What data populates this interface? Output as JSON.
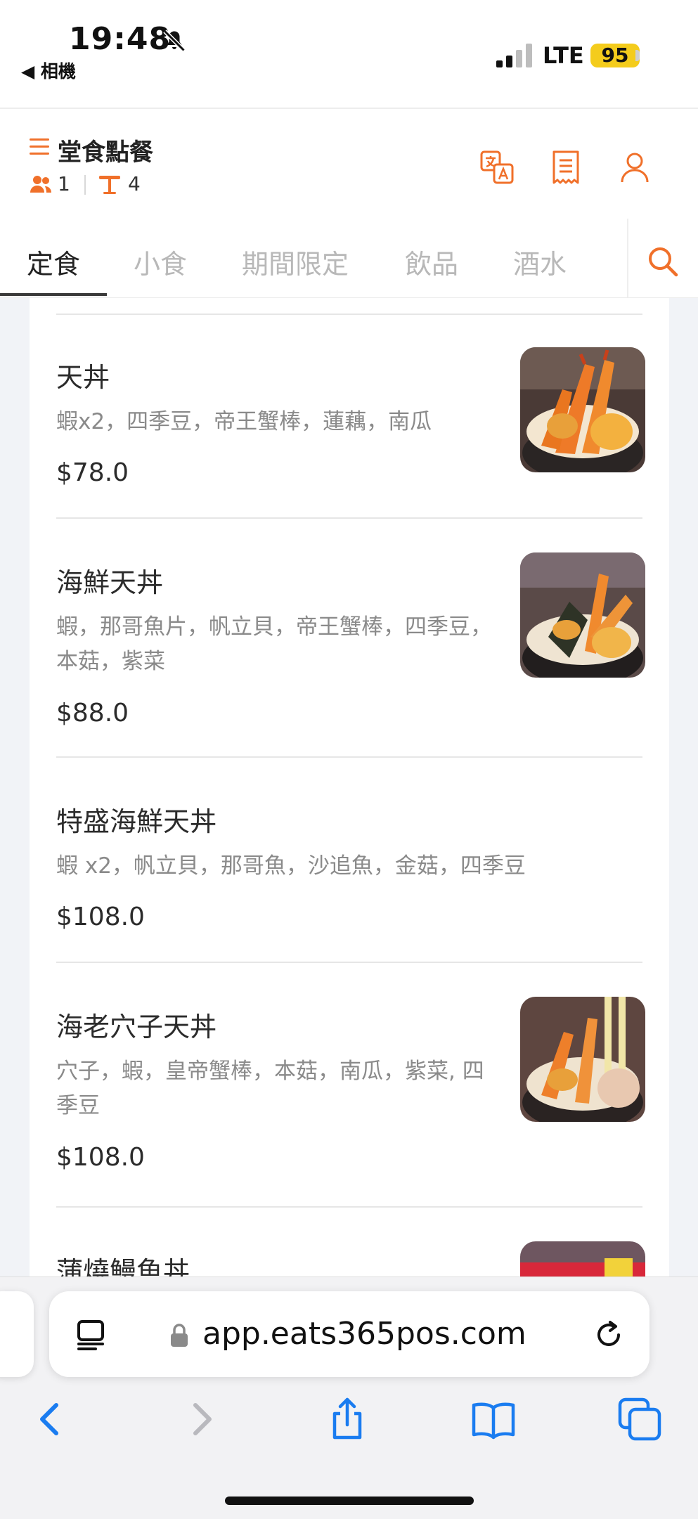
{
  "status_bar": {
    "time": "19:48",
    "back_app": "◀ 相機",
    "network": "LTE",
    "battery": "95"
  },
  "header": {
    "title": "堂食點餐",
    "guests": "1",
    "table": "4",
    "icons": [
      "menu-icon",
      "people-icon",
      "table-icon",
      "translate-icon",
      "receipt-icon",
      "user-icon"
    ],
    "accent_color": "#f0702a"
  },
  "tabs": [
    {
      "label": "定食",
      "active": true
    },
    {
      "label": "小食",
      "active": false
    },
    {
      "label": "期間限定",
      "active": false
    },
    {
      "label": "飲品",
      "active": false
    },
    {
      "label": "酒水",
      "active": false
    }
  ],
  "items": [
    {
      "name": "天丼",
      "desc": "蝦x2，四季豆，帝王蟹棒，蓮藕，南瓜",
      "price": "$78.0",
      "image": "tempura-don-photo"
    },
    {
      "name": "海鮮天丼",
      "desc": "蝦，那哥魚片，帆立貝，帝王蟹棒，四季豆，本菇，紫菜",
      "price": "$88.0",
      "image": "seafood-tempura-don-photo"
    },
    {
      "name": "特盛海鮮天丼",
      "desc": "蝦 x2，帆立貝，那哥魚，沙追魚，金菇，四季豆",
      "price": "$108.0",
      "image": null
    },
    {
      "name": "海老穴子天丼",
      "desc": "穴子，蝦，皇帝蟹棒，本菇，南瓜，紫菜, 四季豆",
      "price": "$108.0",
      "image": "shrimp-eel-tempura-don-photo"
    },
    {
      "name": "蒲燒鰻魚丼",
      "desc": "",
      "price": "",
      "image": "unagi-don-photo"
    }
  ],
  "browser": {
    "url": "app.eats365pos.com",
    "icons": [
      "reader-icon",
      "lock-icon",
      "reload-icon",
      "back-icon",
      "forward-icon",
      "share-icon",
      "bookmarks-icon",
      "tabs-icon"
    ],
    "accent_color": "#1a7cf0"
  }
}
